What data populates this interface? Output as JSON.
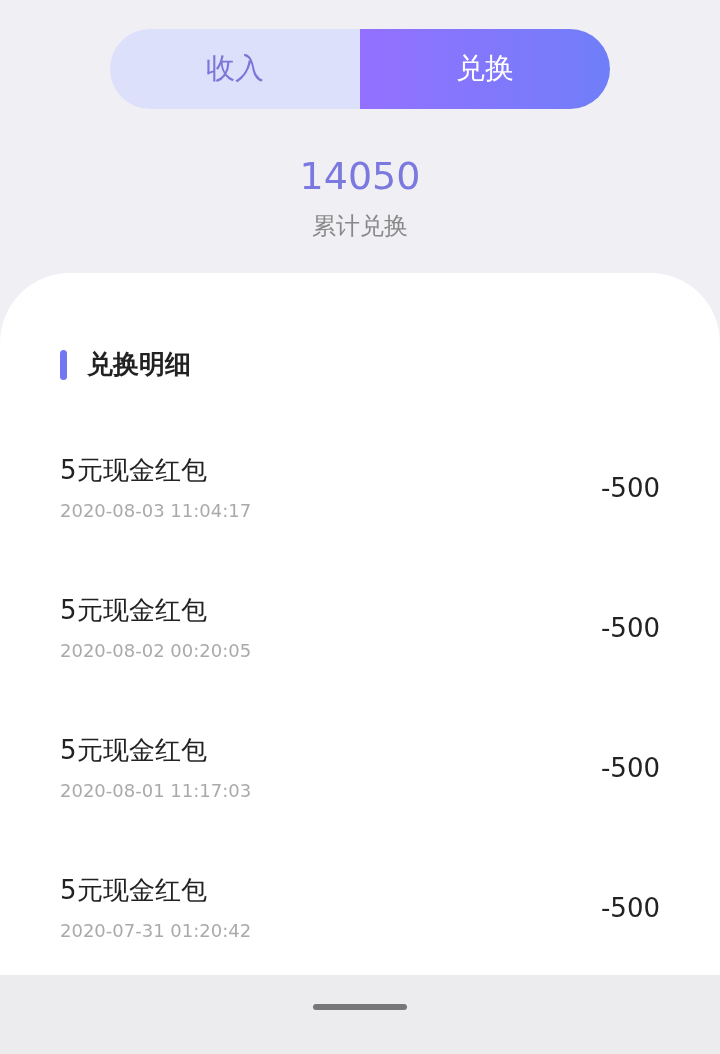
{
  "tabs": [
    {
      "label": "收入",
      "selected": false
    },
    {
      "label": "兑换",
      "selected": true
    }
  ],
  "summary": {
    "value": "14050",
    "label": "累计兑换"
  },
  "section": {
    "title": "兑换明细"
  },
  "records": [
    {
      "title": "5元现金红包",
      "time": "2020-08-03 11:04:17",
      "amount": "-500"
    },
    {
      "title": "5元现金红包",
      "time": "2020-08-02 00:20:05",
      "amount": "-500"
    },
    {
      "title": "5元现金红包",
      "time": "2020-08-01 11:17:03",
      "amount": "-500"
    },
    {
      "title": "5元现金红包",
      "time": "2020-07-31 01:20:42",
      "amount": "-500"
    }
  ]
}
